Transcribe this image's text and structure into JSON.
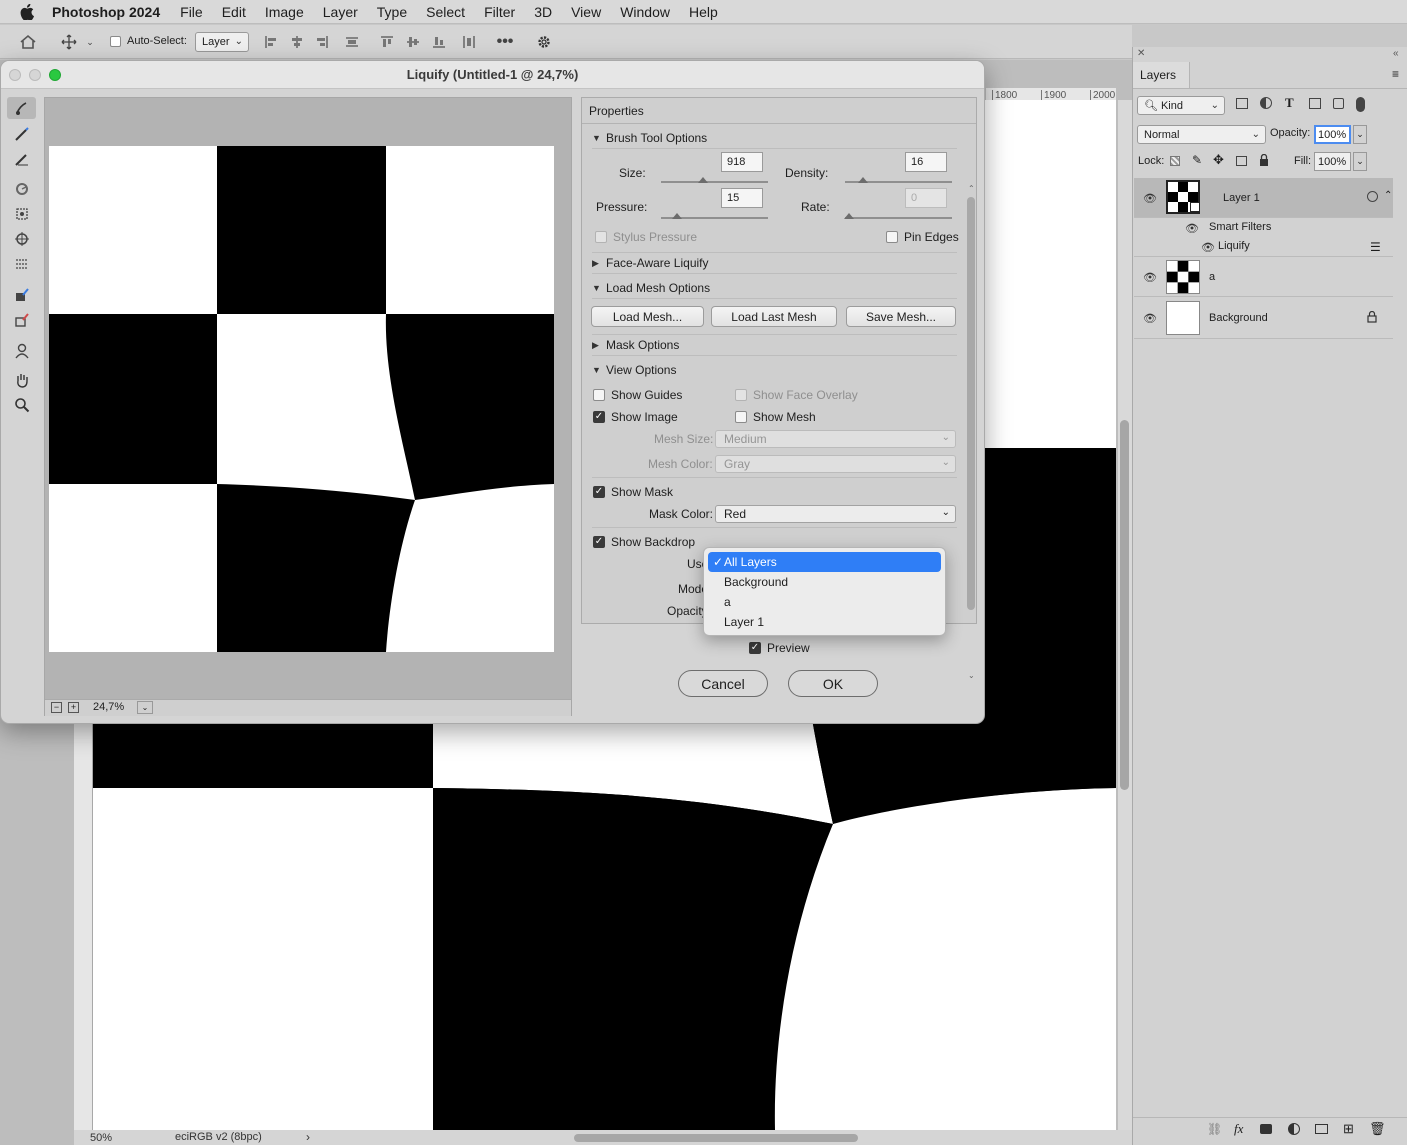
{
  "menubar": {
    "app": "Photoshop 2024",
    "items": [
      "File",
      "Edit",
      "Image",
      "Layer",
      "Type",
      "Select",
      "Filter",
      "3D",
      "View",
      "Window",
      "Help"
    ]
  },
  "options_bar": {
    "auto_select_label": "Auto-Select:",
    "auto_select_value": "Layer"
  },
  "document": {
    "ruler_top_ticks": [
      "1800",
      "1900",
      "2000"
    ],
    "zoom": "50%",
    "color_profile": "eciRGB v2 (8bpc)"
  },
  "dialog": {
    "title": "Liquify (Untitled-1 @ 24,7%)",
    "zoom_value": "24,7%",
    "properties_label": "Properties",
    "brush": {
      "header": "Brush Tool Options",
      "size_label": "Size:",
      "size": "918",
      "density_label": "Density:",
      "density": "16",
      "pressure_label": "Pressure:",
      "pressure": "15",
      "rate_label": "Rate:",
      "rate": "0",
      "stylus_label": "Stylus Pressure",
      "pin_edges_label": "Pin Edges"
    },
    "face_aware": "Face-Aware Liquify",
    "load_mesh": {
      "header": "Load Mesh Options",
      "load": "Load Mesh...",
      "load_last": "Load Last Mesh",
      "save": "Save Mesh..."
    },
    "mask_options": "Mask Options",
    "view": {
      "header": "View Options",
      "show_guides": "Show Guides",
      "show_face_overlay": "Show Face Overlay",
      "show_image": "Show Image",
      "show_mesh": "Show Mesh",
      "mesh_size_label": "Mesh Size:",
      "mesh_size": "Medium",
      "mesh_color_label": "Mesh Color:",
      "mesh_color": "Gray",
      "show_mask": "Show Mask",
      "mask_color_label": "Mask Color:",
      "mask_color": "Red",
      "show_backdrop": "Show Backdrop",
      "use_label": "Use",
      "mode_label": "Mode",
      "opacity_label": "Opacity"
    },
    "use_options": [
      "All Layers",
      "Background",
      "a",
      "Layer 1"
    ],
    "preview_label": "Preview",
    "cancel": "Cancel",
    "ok": "OK"
  },
  "layers_panel": {
    "tab": "Layers",
    "kind": "Kind",
    "blend": "Normal",
    "opacity_label": "Opacity:",
    "opacity": "100%",
    "lock_label": "Lock:",
    "fill_label": "Fill:",
    "fill": "100%",
    "layers": [
      {
        "name": "Layer 1"
      },
      {
        "name": "Smart Filters"
      },
      {
        "name": "Liquify"
      },
      {
        "name": "a"
      },
      {
        "name": "Background"
      }
    ]
  }
}
